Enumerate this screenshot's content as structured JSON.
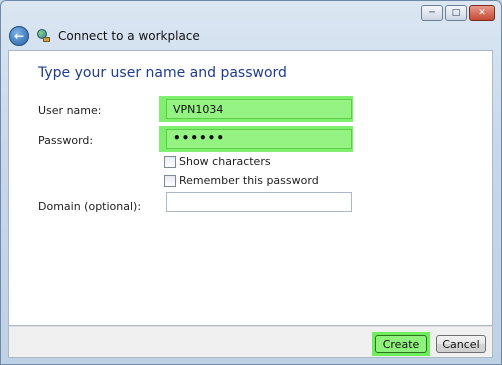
{
  "window": {
    "title": "Connect to a workplace",
    "controls": {
      "minimize": "─",
      "maximize": "□",
      "close": "✕"
    }
  },
  "form": {
    "heading": "Type your user name and password",
    "username": {
      "label": "User name:",
      "value": "VPN1034"
    },
    "password": {
      "label": "Password:",
      "value": "••••••"
    },
    "show_characters": {
      "label": "Show characters",
      "checked": false
    },
    "remember_password": {
      "label": "Remember this password",
      "checked": false
    },
    "domain": {
      "label": "Domain (optional):",
      "value": ""
    }
  },
  "footer": {
    "create_label": "Create",
    "cancel_label": "Cancel"
  },
  "colors": {
    "highlight": "#7fef6e",
    "heading": "#1f3c8c"
  },
  "icons": {
    "back": "back-arrow-icon",
    "app": "network-connection-icon"
  }
}
